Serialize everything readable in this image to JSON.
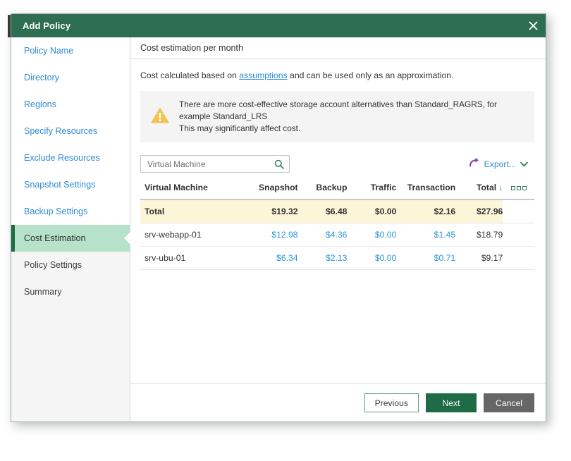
{
  "window": {
    "title": "Add Policy",
    "close_icon": "close-icon"
  },
  "sidebar": {
    "items": [
      {
        "label": "Policy Name",
        "state": "done"
      },
      {
        "label": "Directory",
        "state": "done"
      },
      {
        "label": "Regions",
        "state": "done"
      },
      {
        "label": "Specify Resources",
        "state": "done"
      },
      {
        "label": "Exclude Resources",
        "state": "done"
      },
      {
        "label": "Snapshot Settings",
        "state": "done"
      },
      {
        "label": "Backup Settings",
        "state": "done"
      },
      {
        "label": "Cost Estimation",
        "state": "active"
      },
      {
        "label": "Policy Settings",
        "state": "future"
      },
      {
        "label": "Summary",
        "state": "future"
      }
    ]
  },
  "content": {
    "header": "Cost estimation per month",
    "intro_prefix": "Cost calculated based on ",
    "intro_link": "assumptions",
    "intro_suffix": " and can be used only as an approximation.",
    "warning": {
      "icon": "warning-triangle-icon",
      "line1": "There are more cost-effective storage account alternatives than Standard_RAGRS, for example Standard_LRS",
      "line2": "This may significantly affect cost."
    }
  },
  "toolbar": {
    "search_placeholder": "Virtual Machine",
    "search_value": "",
    "search_icon": "search-icon",
    "export_icon": "export-arrow-icon",
    "export_label": "Export...",
    "export_chevron": "chevron-down-icon"
  },
  "table": {
    "columns": [
      "Virtual Machine",
      "Snapshot",
      "Backup",
      "Traffic",
      "Transaction",
      "Total"
    ],
    "sorted_column": "Total",
    "sort_direction_glyph": "↓",
    "options_icon": "column-options-icon",
    "total_row": {
      "name": "Total",
      "snapshot": "$19.32",
      "backup": "$6.48",
      "traffic": "$0.00",
      "transaction": "$2.16",
      "total": "$27.96"
    },
    "rows": [
      {
        "name": "srv-webapp-01",
        "snapshot": "$12.98",
        "backup": "$4.36",
        "traffic": "$0.00",
        "transaction": "$1.45",
        "total": "$18.79"
      },
      {
        "name": "srv-ubu-01",
        "snapshot": "$6.34",
        "backup": "$2.13",
        "traffic": "$0.00",
        "transaction": "$0.71",
        "total": "$9.17"
      }
    ]
  },
  "footer": {
    "previous_label": "Previous",
    "next_label": "Next",
    "cancel_label": "Cancel"
  },
  "colors": {
    "title_bar_green": "#2d6e52",
    "active_nav_green": "#b5e2c8",
    "active_nav_bar": "#1f6b45",
    "link_blue": "#2e8bd6",
    "money_blue": "#2e96d9",
    "total_row_yellow": "#fdf5d7",
    "warning_amber": "#f2c14e",
    "export_purple": "#8a3fa8",
    "primary_button_green": "#1f6b45",
    "cancel_gray": "#666666"
  }
}
